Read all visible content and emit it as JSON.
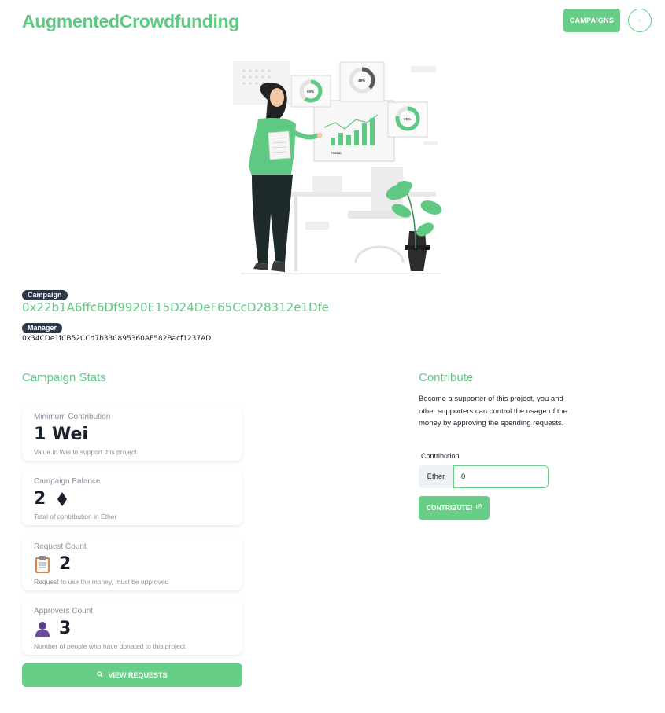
{
  "header": {
    "brand": "AugmentedCrowdfunding",
    "campaigns_button": "CAMPAIGNS",
    "profile_icon": "circle-icon"
  },
  "hero": {
    "chart_labels": [
      "60%",
      "38%",
      "78%",
      "TREND"
    ]
  },
  "campaign": {
    "tag": "Campaign",
    "address": "0x22b1A6ffc6Df9920E15D24DeF65CcD28312e1Dfe",
    "manager_tag": "Manager",
    "manager_address": "0x34CDe1fCB52CCd7b33C895360AF582Bacf1237AD"
  },
  "stats": {
    "title": "Campaign Stats",
    "cards": [
      {
        "label": "Minimum Contribution",
        "value": "1 Wei",
        "help": "Value in Wei to support this project",
        "icon": ""
      },
      {
        "label": "Campaign Balance",
        "value": "2",
        "help": "Total of contribution in Ether",
        "icon": "ether-diamond-icon"
      },
      {
        "label": "Request Count",
        "value": "2",
        "help": "Request to use the money, must be approved",
        "icon": "clipboard-icon"
      },
      {
        "label": "Approvers Count",
        "value": "3",
        "help": "Number of people who have donated to this project",
        "icon": "person-icon"
      }
    ],
    "view_requests_button": "VIEW REQUESTS"
  },
  "contribute": {
    "title": "Contribute",
    "description": "Become a supporter of this project, you and other supporters can control the usage of the money by approving the spending requests.",
    "field_label": "Contribution",
    "addon": "Ether",
    "input_value": "0",
    "button": "CONTRIBUTE!"
  },
  "colors": {
    "accent": "#68cd87",
    "dark_tag": "#2d3748"
  }
}
